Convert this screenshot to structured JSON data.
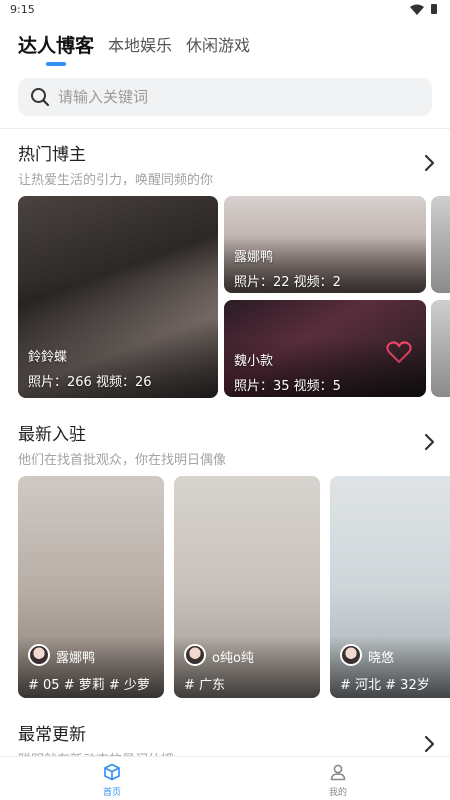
{
  "status_bar": {
    "time": "9:15"
  },
  "tabs": [
    {
      "label": "达人博客",
      "active": true
    },
    {
      "label": "本地娱乐",
      "active": false
    },
    {
      "label": "休闲游戏",
      "active": false
    }
  ],
  "colors": {
    "accent": "#2f8ff5",
    "muted_text": "#a3a3a3"
  },
  "search": {
    "placeholder": "请输入关键词"
  },
  "hot_bloggers": {
    "title": "热门博主",
    "subtitle": "让热爱生活的引力，唤醒同频的你",
    "cards": [
      {
        "name": "鈴鈴蝶",
        "stats": "照片：266  视频：26"
      },
      {
        "name": "露娜鸭",
        "stats": "照片：22  视频：2"
      },
      {
        "name": "魏小款",
        "stats": "照片：35  视频：5"
      }
    ]
  },
  "newest": {
    "title": "最新入驻",
    "subtitle": "他们在找首批观众，你在找明日偶像",
    "cards": [
      {
        "name": "露娜鸭",
        "tags": "# 05  # 萝莉  # 少萝"
      },
      {
        "name": "o纯o纯",
        "tags": "# 广东"
      },
      {
        "name": "晓悠",
        "tags": "# 河北  # 32岁"
      }
    ]
  },
  "most_updated": {
    "title": "最常更新",
    "subtitle": "聪明就有新动态的最闪仙娥"
  },
  "bottom_nav": [
    {
      "label": "首页",
      "icon": "cube-icon",
      "active": true
    },
    {
      "label": "我的",
      "icon": "person-icon",
      "active": false
    }
  ]
}
